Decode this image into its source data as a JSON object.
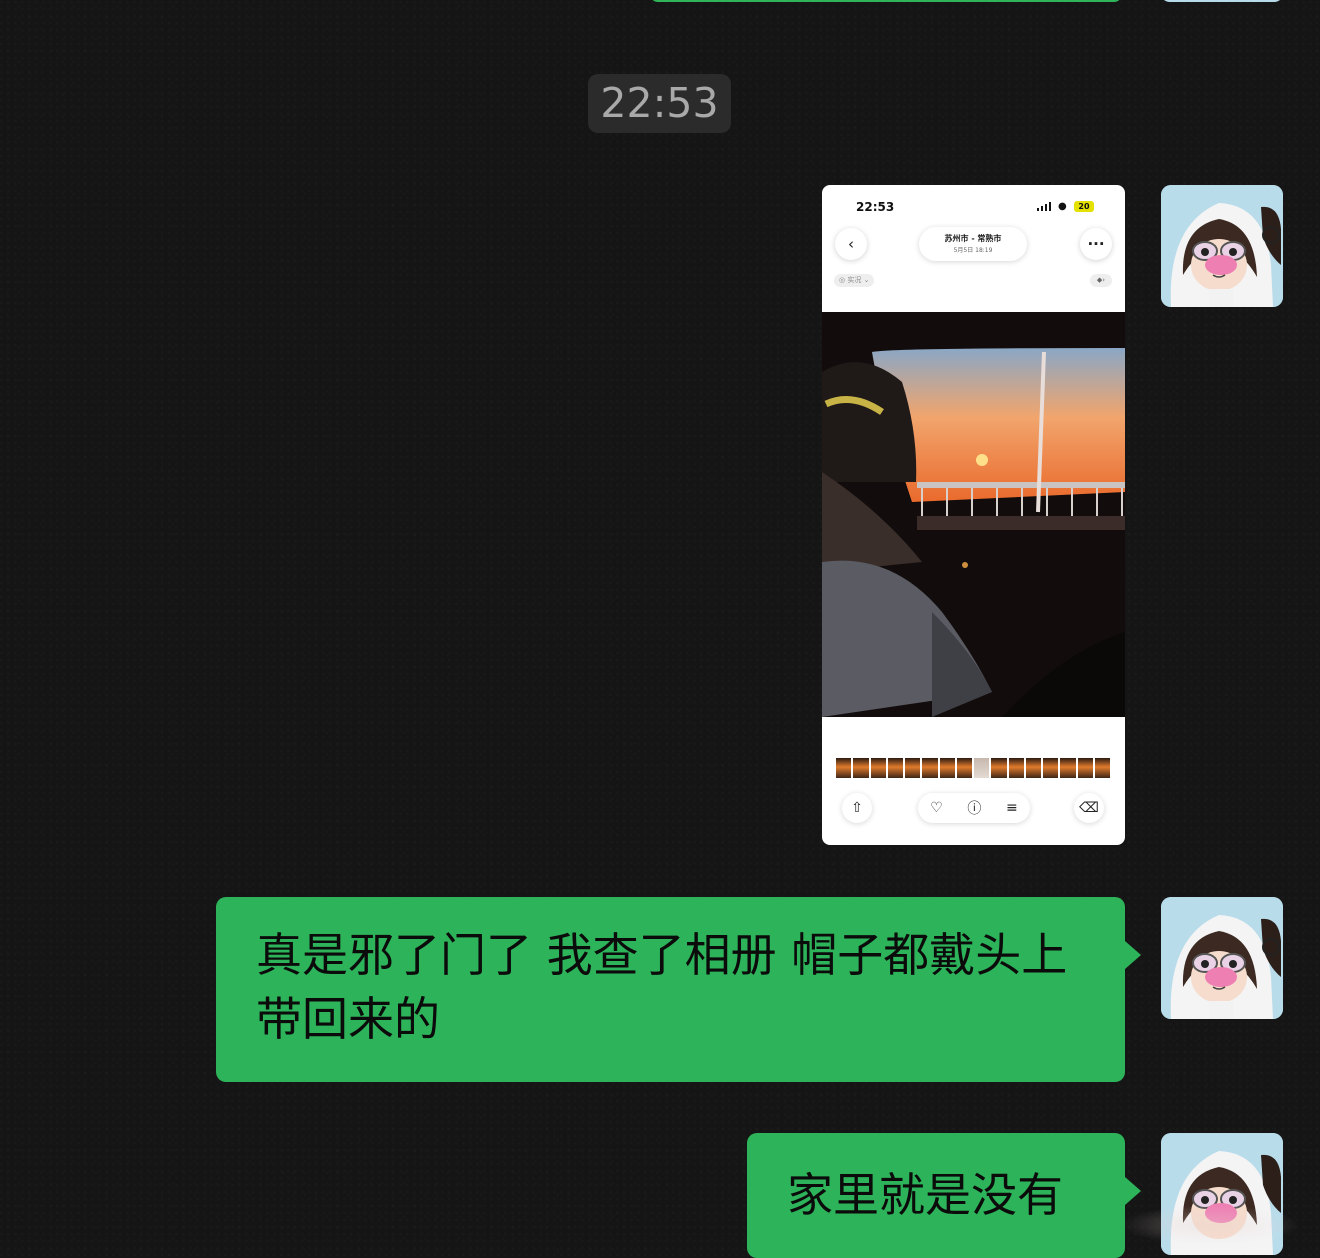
{
  "chat": {
    "timestamp": "22:53",
    "messages": [
      {
        "type": "image",
        "sender": "self"
      },
      {
        "type": "text",
        "sender": "self",
        "text": "真是邪了门了 我查了相册 帽子都戴头上带回来的"
      },
      {
        "type": "text",
        "sender": "self",
        "text": "家里就是没有"
      }
    ]
  },
  "screenshot": {
    "status_time": "22:53",
    "battery": "20",
    "title": "苏州市 - 常熟市",
    "date": "5月5日 18:19",
    "live_label": "实况",
    "icons": [
      "back-chevron-icon",
      "more-dots-icon",
      "share-icon",
      "heart-icon",
      "info-icon",
      "adjust-icon",
      "trash-icon"
    ]
  },
  "colors": {
    "bubble": "#2db359",
    "background": "#151515",
    "timestamp_bg": "#2b2b2b"
  }
}
